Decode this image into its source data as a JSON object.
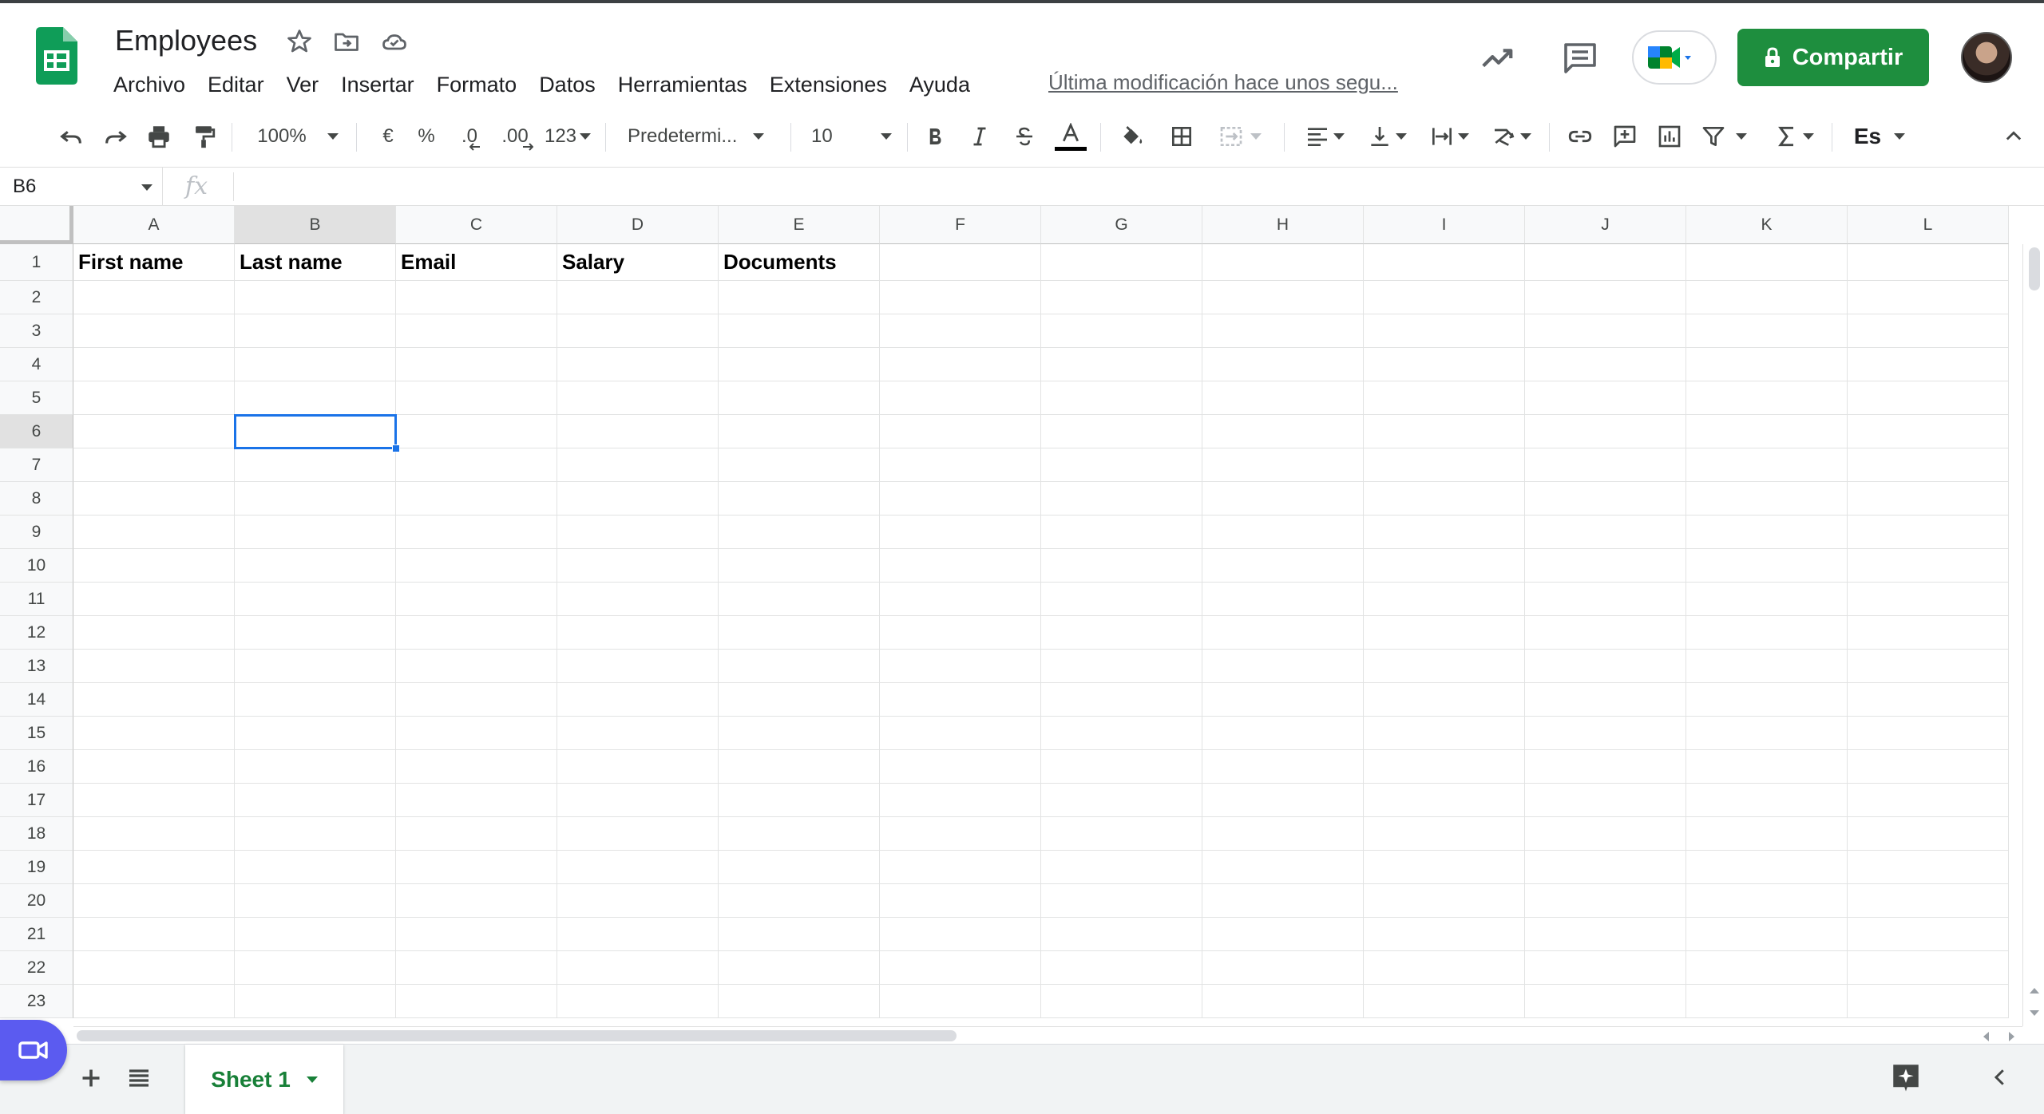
{
  "app": {
    "title": "Employees",
    "last_edit": "Última modificación hace unos segu..."
  },
  "menu": [
    "Archivo",
    "Editar",
    "Ver",
    "Insertar",
    "Formato",
    "Datos",
    "Herramientas",
    "Extensiones",
    "Ayuda"
  ],
  "header": {
    "share_label": "Compartir"
  },
  "toolbar": {
    "zoom": "100%",
    "currency": "€",
    "percent": "%",
    "decrease_decimals": ".0",
    "increase_decimals": ".00",
    "number_format": "123",
    "font": "Predetermi...",
    "font_size": "10",
    "input_tools": "Es"
  },
  "formula_bar": {
    "cell_ref": "B6",
    "fx": "fx",
    "content": ""
  },
  "grid": {
    "columns": [
      "A",
      "B",
      "C",
      "D",
      "E",
      "F",
      "G",
      "H",
      "I",
      "J",
      "K",
      "L"
    ],
    "rows": [
      "1",
      "2",
      "3",
      "4",
      "5",
      "6",
      "7",
      "8",
      "9",
      "10",
      "11",
      "12",
      "13",
      "14",
      "15",
      "16",
      "17",
      "18",
      "19",
      "20",
      "21",
      "22",
      "23"
    ],
    "header_row": [
      "First name",
      "Last name",
      "Email",
      "Salary",
      "Documents"
    ],
    "selected_cell": "B6",
    "selected_column": "B",
    "selected_row": "6"
  },
  "sheets": {
    "tabs": [
      "Sheet 1"
    ],
    "active": "Sheet 1"
  },
  "colors": {
    "share_bg": "#1e8e3e",
    "selection": "#1a73e8",
    "sheet_tab_text": "#188038",
    "meet_fab": "#5b5bf0"
  }
}
